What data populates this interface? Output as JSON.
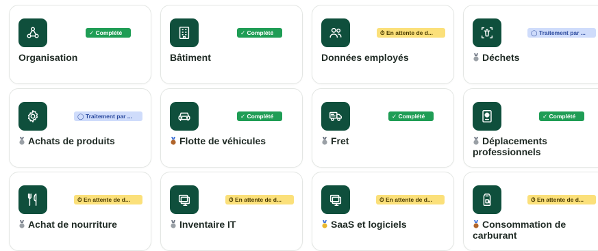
{
  "cards": [
    {
      "title": "Organisation",
      "medal": "",
      "status": "done",
      "status_label": "✓ Complété",
      "icon": "network-icon"
    },
    {
      "title": "Bâtiment",
      "medal": "",
      "status": "done",
      "status_label": "✓ Complété",
      "icon": "building-icon"
    },
    {
      "title": "Données employés",
      "medal": "",
      "status": "wait",
      "status_label": "⏱ En attente de d...",
      "icon": "users-icon"
    },
    {
      "title": "Déchets",
      "medal": "silver",
      "status": "proc",
      "status_label": "◯ Traitement par ...",
      "icon": "trash-scan-icon"
    },
    {
      "title": "Achats de produits",
      "medal": "silver",
      "status": "proc",
      "status_label": "◯ Traitement par ...",
      "icon": "gear-icon"
    },
    {
      "title": "Flotte de véhicules",
      "medal": "bronze",
      "status": "done",
      "status_label": "✓ Complété",
      "icon": "car-icon"
    },
    {
      "title": "Fret",
      "medal": "silver",
      "status": "done",
      "status_label": "✓ Complété",
      "icon": "truck-icon"
    },
    {
      "title": "Déplacements professionnels",
      "medal": "silver",
      "status": "done",
      "status_label": "✓ Complété",
      "icon": "passport-icon"
    },
    {
      "title": "Achat de nourriture",
      "medal": "silver",
      "status": "wait",
      "status_label": "⏱ En attente de d...",
      "icon": "fork-knife-icon"
    },
    {
      "title": "Inventaire IT",
      "medal": "silver",
      "status": "wait",
      "status_label": "⏱ En attente de d...",
      "icon": "monitor-icon"
    },
    {
      "title": "SaaS et logiciels",
      "medal": "gold",
      "status": "wait",
      "status_label": "⏱ En attente de d...",
      "icon": "monitor-icon"
    },
    {
      "title": "Consommation de carburant",
      "medal": "bronze",
      "status": "wait",
      "status_label": "⏱ En attente de d...",
      "icon": "fuel-doc-icon"
    }
  ],
  "colors": {
    "icon_bg": "#0f4f3c",
    "done": "#1f9d55",
    "wait": "#fbe07a",
    "proc": "#cfdcfb",
    "gold": "#e8b730",
    "silver": "#9aa0a6",
    "bronze": "#b0652b"
  }
}
